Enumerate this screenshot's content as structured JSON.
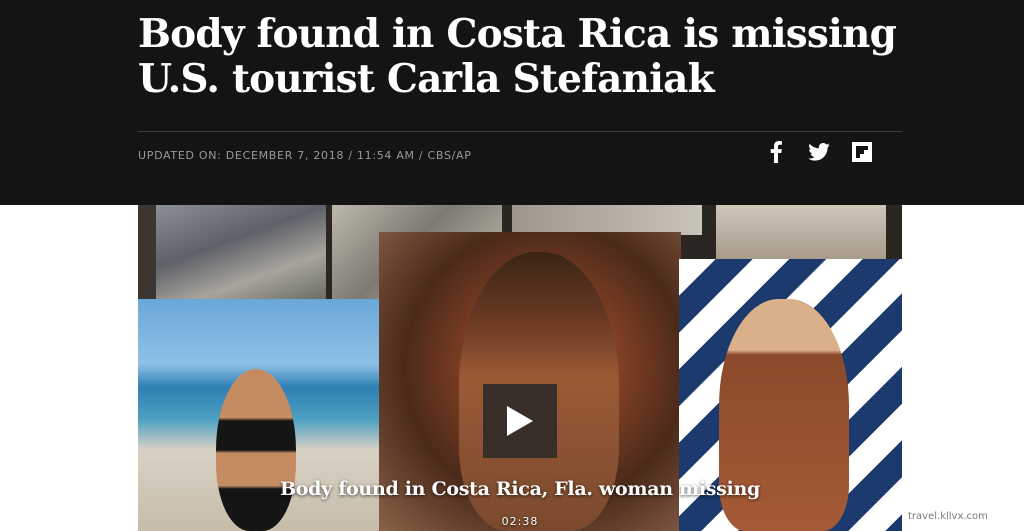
{
  "article": {
    "headline": "Body found in Costa Rica is missing U.S. tourist Carla Stefaniak",
    "meta": "UPDATED ON: DECEMBER 7, 2018 / 11:54 AM / CBS/AP"
  },
  "share": {
    "icons": [
      "facebook-icon",
      "twitter-icon",
      "flipboard-icon"
    ]
  },
  "video": {
    "caption": "Body found in Costa Rica, Fla. woman missing",
    "duration": "02:38"
  },
  "watermark": "travel.kllvx.com",
  "colors": {
    "header_bg": "#141414",
    "meta_text": "#9a9a9a"
  }
}
